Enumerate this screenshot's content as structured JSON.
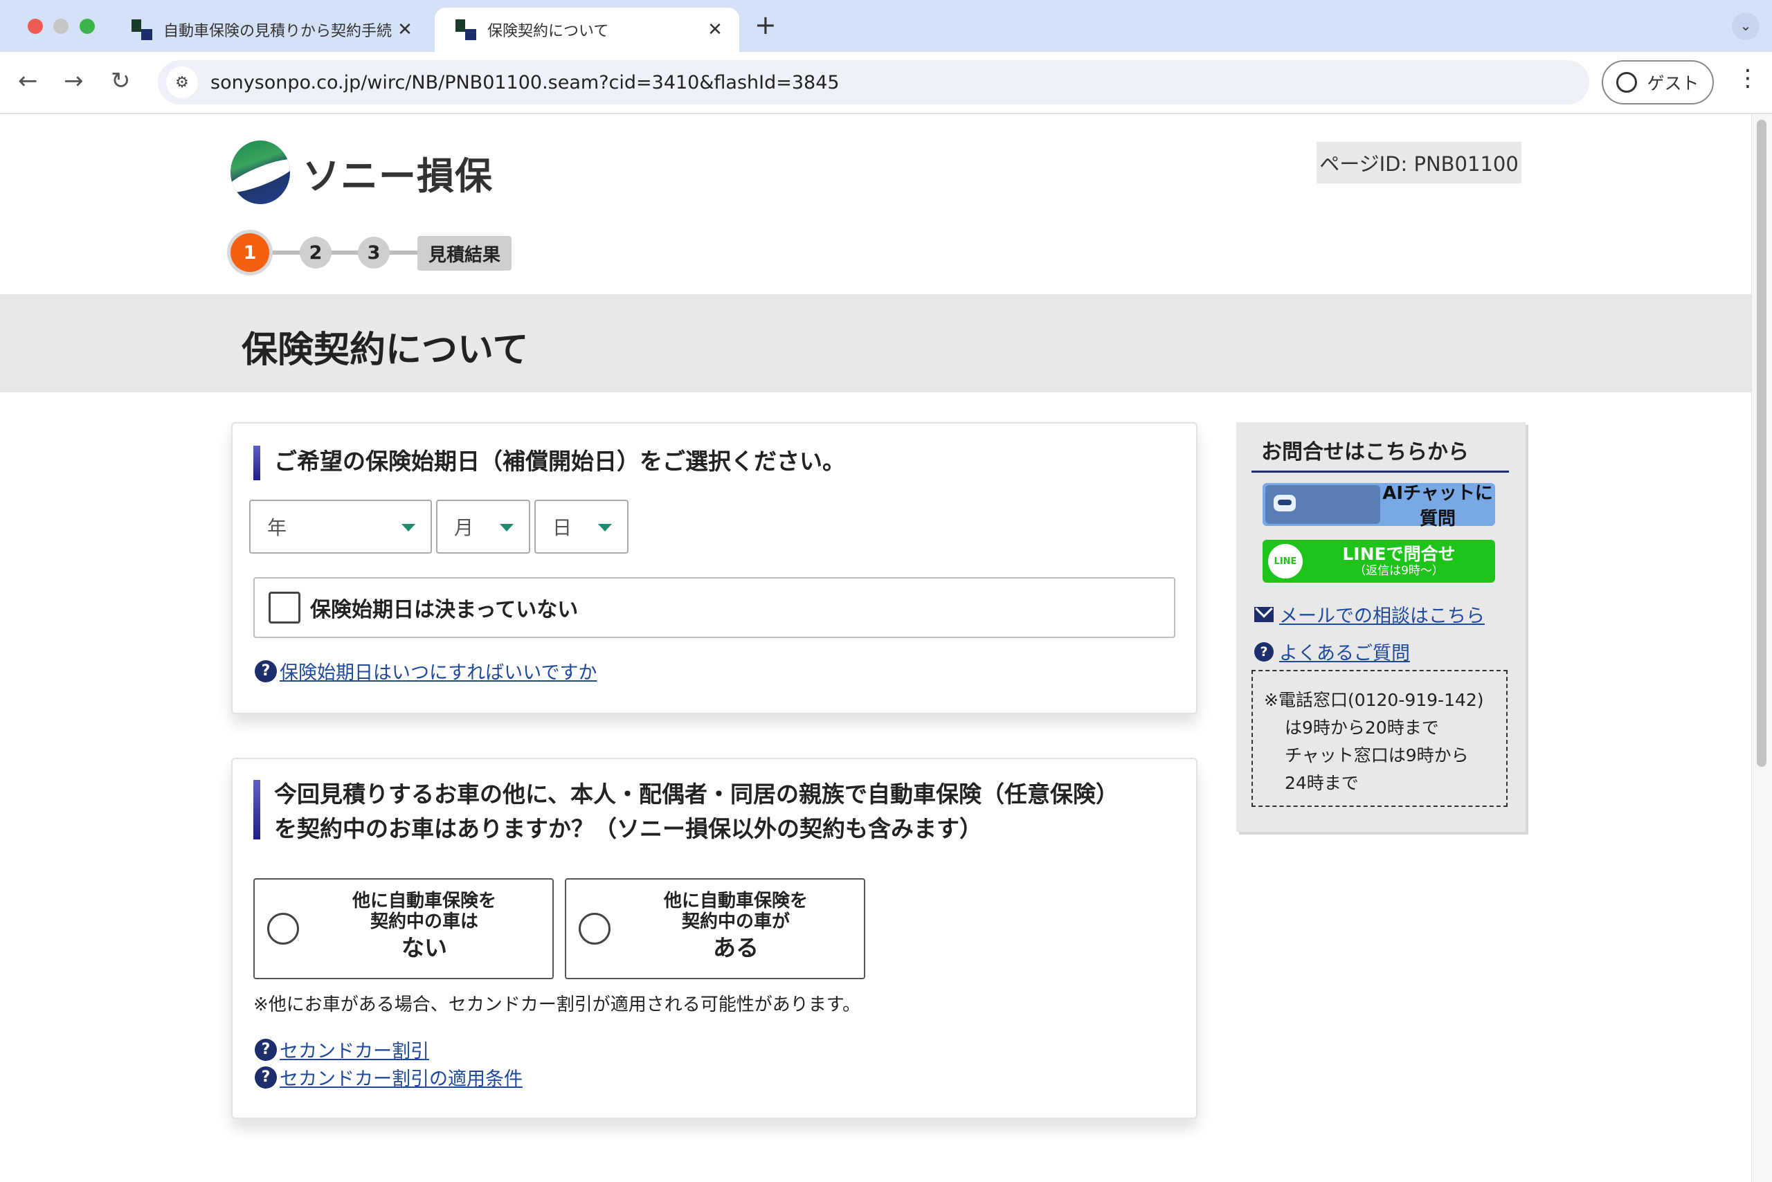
{
  "browser": {
    "tabs": [
      {
        "title": "自動車保険の見積りから契約手続",
        "close": "✕"
      },
      {
        "title": "保険契約について",
        "close": "✕"
      }
    ],
    "new_tab": "+",
    "tab_search": "⌄",
    "url": "sonysonpo.co.jp/wirc/NB/PNB01100.seam?cid=3410&flashId=3845",
    "profile_label": "ゲスト",
    "back": "←",
    "forward": "→",
    "reload": "↻",
    "menu": "⋮",
    "site_info": "⚙"
  },
  "header": {
    "brand": "ソニー損保",
    "page_id": "ページID: PNB01100"
  },
  "steps": {
    "items": [
      "1",
      "2",
      "3"
    ],
    "result_label": "見積結果",
    "current": 1
  },
  "page_title": "保険契約について",
  "start_date_section": {
    "heading": "ご希望の保険始期日（補償開始日）をご選択ください。",
    "year_select": "年",
    "month_select": "月",
    "day_select": "日",
    "undecided_checkbox_label": "保険始期日は決まっていない",
    "help_icon": "?",
    "help_link": "保険始期日はいつにすればいいですか"
  },
  "other_car_section": {
    "heading_line1": "今回見積りするお車の他に、本人・配偶者・同居の親族で自動車保険（任意保険）",
    "heading_line2": "を契約中のお車はありますか？（ソニー損保以外の契約も含みます）",
    "option_no": {
      "line1": "他に自動車保険を",
      "line2": "契約中の車は",
      "emph": "ない"
    },
    "option_yes": {
      "line1": "他に自動車保険を",
      "line2": "契約中の車が",
      "emph": "ある"
    },
    "note": "※他にお車がある場合、セカンドカー割引が適用される可能性があります。",
    "help_icon": "?",
    "link1": "セカンドカー割引",
    "link2": "セカンドカー割引の適用条件"
  },
  "sidebar": {
    "title": "お問合せはこちらから",
    "ai_chat_label": "AIチャットに質問",
    "line_label": "LINEで問合せ",
    "line_sub": "（返信は9時～）",
    "line_icon_text": "LINE",
    "mail_link": "メールでの相談はこちら",
    "faq_link": "よくあるご質問",
    "faq_icon": "?",
    "tel_note_lines": [
      "※電話窓口(0120-919-142)",
      "は9時から20時まで",
      "チャット窓口は9時から",
      "24時まで"
    ]
  },
  "colors": {
    "tabbar_bg": "#d5e1f7",
    "step_active": "#f46012",
    "heading_bar": "#2a2a9c",
    "line_green": "#1ec41a",
    "ai_blue": "#79a8e6",
    "link": "#1f4a9a"
  }
}
